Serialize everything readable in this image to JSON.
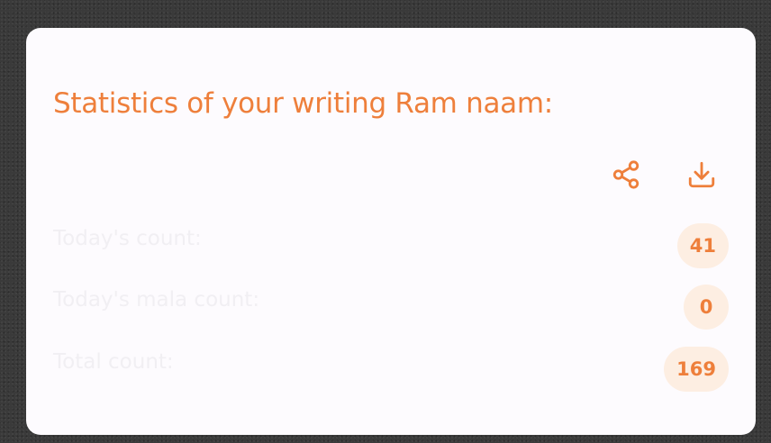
{
  "card": {
    "title": "Statistics of your writing Ram naam:"
  },
  "actions": {
    "share_icon": "share-icon",
    "download_icon": "download-icon"
  },
  "stats": [
    {
      "label": "Today's count:",
      "value": "41"
    },
    {
      "label": "Today's mala count:",
      "value": "0"
    },
    {
      "label": "Total count:",
      "value": "169"
    }
  ],
  "colors": {
    "accent": "#ee7f3b",
    "pill_background": "#fdeee2",
    "card_background": "#fdfbfe",
    "label_text": "#f1eff3"
  }
}
